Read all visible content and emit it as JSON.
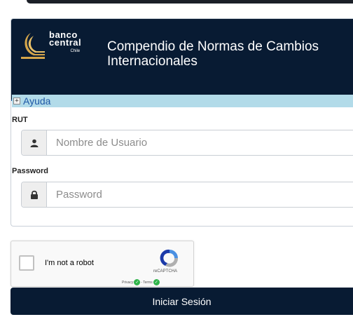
{
  "logo": {
    "line1": "banco",
    "line2": "central",
    "line3": "Chile"
  },
  "header": {
    "title_line1": "Compendio de Normas de Cambios",
    "title_line2": "Internacionales"
  },
  "help": {
    "toggle_symbol": "+",
    "label": "Ayuda"
  },
  "form": {
    "rut_label": "RUT",
    "rut_placeholder": "Nombre de Usuario",
    "password_label": "Password",
    "password_placeholder": "Password"
  },
  "captcha": {
    "label": "I'm not a robot",
    "brand": "reCAPTCHA",
    "privacy": "Privacy",
    "terms": "Terms",
    "separator": "-"
  },
  "submit": {
    "label": "Iniciar Sesión"
  },
  "colors": {
    "brand_navy": "#081b33",
    "help_bar": "#b2dbe9",
    "help_text": "#1e57a6"
  }
}
